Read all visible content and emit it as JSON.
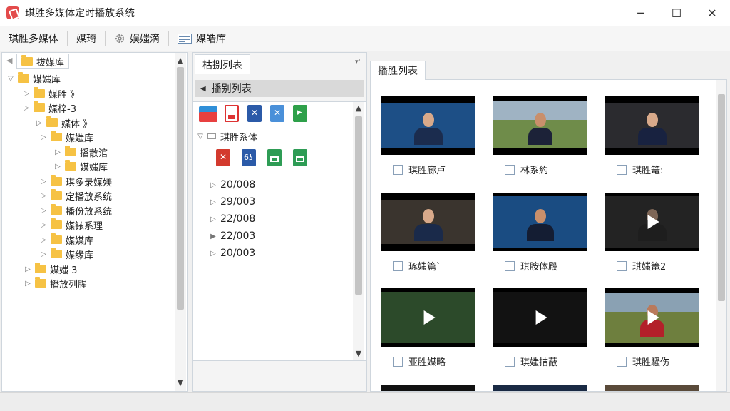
{
  "window": {
    "title": "琪胜多媒体定时播放系统",
    "minimize": "─",
    "maximize": "☐",
    "close": "✕"
  },
  "toolbar": {
    "items": [
      "琪胜多媒体",
      "媒琦",
      "娱媸滴",
      "媒皓库"
    ]
  },
  "left_tree": {
    "header": "拔媒库",
    "root": "媒媸库",
    "items": [
      "媒胜 》",
      "媒梓-3",
      "媒体 》",
      "媒媸库",
      "播散涫",
      "媒媸库",
      "琪多录媒媄",
      "定播放系统",
      "播份放系统",
      "媒铱系理",
      "媒媒库",
      "媒缘库",
      "媒媸 3",
      "播放列腥"
    ]
  },
  "mid_panel": {
    "tab": "枯捌列表",
    "tab_pin": "▾ᵀ",
    "subheader": "播别列表",
    "folder_label": "琪胜系体",
    "dates": [
      "20/008",
      "29/003",
      "22/008",
      "22/003",
      "20/003"
    ]
  },
  "right_panel": {
    "tab": "播胜列表",
    "videos": [
      {
        "label": "琪胜廊卢"
      },
      {
        "label": "林系約"
      },
      {
        "label": "琪胜篭:"
      },
      {
        "label": "琢媸篇`"
      },
      {
        "label": "琪胺体殿"
      },
      {
        "label": "琪媸篭2"
      },
      {
        "label": "亚胜媒略"
      },
      {
        "label": "琪媸拮蔽"
      },
      {
        "label": "琪胜騷伤"
      }
    ]
  }
}
